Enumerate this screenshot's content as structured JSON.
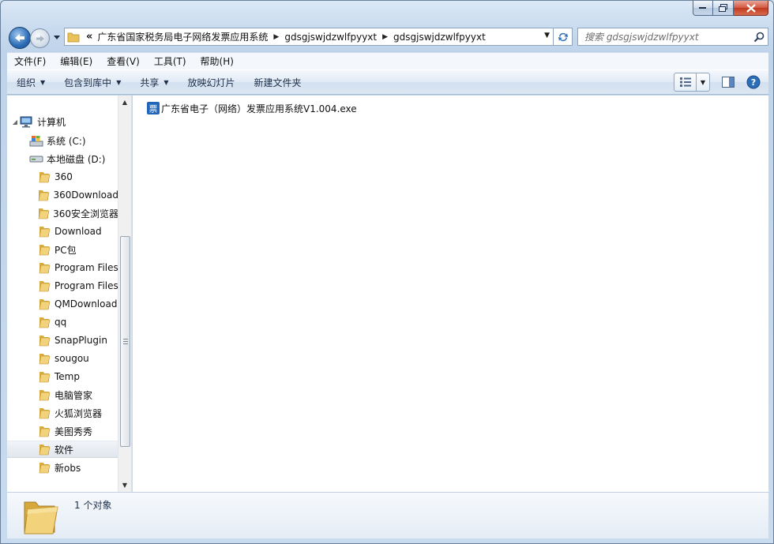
{
  "window": {
    "caption_buttons": [
      "minimize",
      "maximize",
      "close"
    ]
  },
  "nav": {
    "address_overflow": "«",
    "breadcrumbs": [
      "广东省国家税务局电子网络发票应用系统",
      "gdsgjswjdzwlfpyyxt",
      "gdsgjswjdzwlfpyyxt"
    ],
    "search_placeholder": "搜索 gdsgjswjdzwlfpyyxt"
  },
  "menubar": {
    "items": [
      "文件(F)",
      "编辑(E)",
      "查看(V)",
      "工具(T)",
      "帮助(H)"
    ]
  },
  "commandbar": {
    "organize": "组织",
    "include_library": "包含到库中",
    "share": "共享",
    "slideshow": "放映幻灯片",
    "new_folder": "新建文件夹"
  },
  "navpane": {
    "computer": "计算机",
    "drive_c": "系统 (C:)",
    "drive_d": "本地磁盘 (D:)",
    "folders": [
      "360",
      "360Download",
      "360安全浏览器",
      "Download",
      "PC包",
      "Program Files",
      "Program Files",
      "QMDownload",
      "qq",
      "SnapPlugin",
      "sougou",
      "Temp",
      "电脑管家",
      "火狐浏览器",
      "美图秀秀",
      "软件",
      "新obs"
    ],
    "selected_folder": "软件"
  },
  "content": {
    "files": [
      {
        "name": "广东省电子（网络）发票应用系统V1.004.exe",
        "icon": "invoice-app-icon",
        "icon_glyph": "票"
      }
    ]
  },
  "details": {
    "item_count": "1 个对象"
  },
  "colors": {
    "accent": "#2b6db6",
    "folder": "#e9c35a",
    "close": "#c1391f"
  }
}
